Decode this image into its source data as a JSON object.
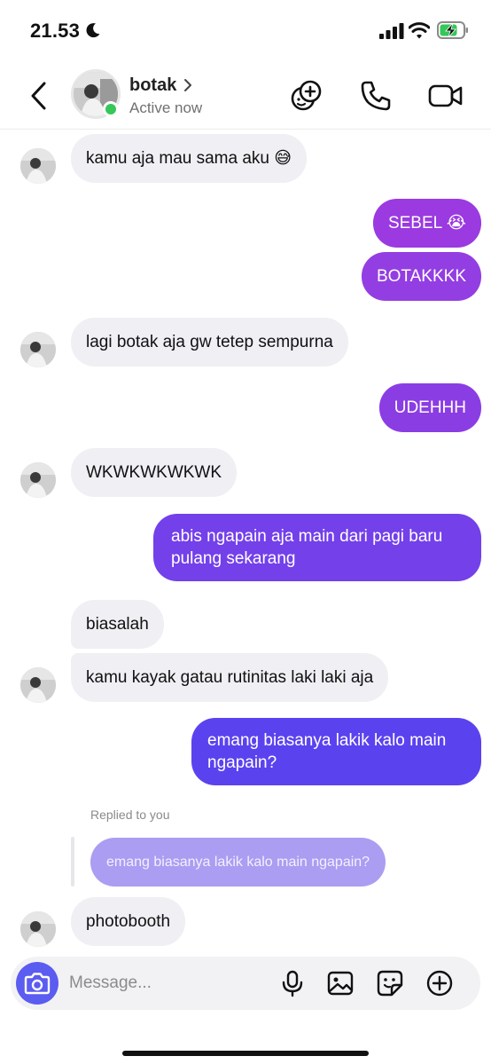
{
  "status_bar": {
    "time": "21.53"
  },
  "header": {
    "contact_name": "botak",
    "activity": "Active now",
    "online": true
  },
  "colors": {
    "accent": "#5b5cf0",
    "outgoing_top": "#9a3ae0",
    "outgoing_bottom": "#5a42ef",
    "incoming": "#efeff4",
    "online": "#35c759"
  },
  "messages": [
    {
      "from": "them",
      "text": "kamu aja mau sama aku 😅"
    },
    {
      "from": "me",
      "text": "SEBEL 😭"
    },
    {
      "from": "me",
      "text": "BOTAKKKK"
    },
    {
      "from": "them",
      "text": "lagi botak aja gw tetep sempurna"
    },
    {
      "from": "me",
      "text": "UDEHHH"
    },
    {
      "from": "them",
      "text": "WKWKWKWKWK"
    },
    {
      "from": "me",
      "text": "abis ngapain aja main dari pagi baru pulang sekarang"
    },
    {
      "from": "them",
      "text": "biasalah"
    },
    {
      "from": "them",
      "text": "kamu kayak gatau rutinitas laki laki aja"
    },
    {
      "from": "me",
      "text": "emang biasanya lakik kalo main ngapain?"
    },
    {
      "from": "them",
      "text": "photobooth",
      "reply": {
        "label": "Replied to you",
        "quote": "emang biasanya lakik kalo main ngapain?"
      }
    }
  ],
  "composer": {
    "placeholder": "Message..."
  },
  "icons": {
    "back": "chevron-left-icon",
    "profile": "chevron-right-icon",
    "effects": "sticker-faces-icon",
    "call": "phone-icon",
    "video": "video-camera-icon",
    "camera": "camera-icon",
    "mic": "microphone-icon",
    "gallery": "image-icon",
    "sticker": "sticker-icon",
    "more": "plus-circle-icon"
  }
}
